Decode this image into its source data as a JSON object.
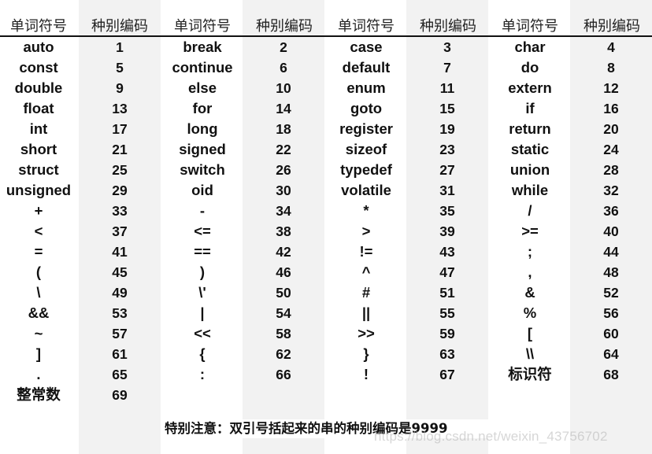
{
  "headers": {
    "symbol": "单词符号",
    "code": "种别编码"
  },
  "columns": [
    [
      {
        "symbol": "auto",
        "code": "1"
      },
      {
        "symbol": "const",
        "code": "5"
      },
      {
        "symbol": "double",
        "code": "9"
      },
      {
        "symbol": "float",
        "code": "13"
      },
      {
        "symbol": "int",
        "code": "17"
      },
      {
        "symbol": "short",
        "code": "21"
      },
      {
        "symbol": "struct",
        "code": "25"
      },
      {
        "symbol": "unsigned",
        "code": "29"
      },
      {
        "symbol": "+",
        "code": "33"
      },
      {
        "symbol": "<",
        "code": "37"
      },
      {
        "symbol": "=",
        "code": "41"
      },
      {
        "symbol": "(",
        "code": "45"
      },
      {
        "symbol": "\\",
        "code": "49"
      },
      {
        "symbol": "&&",
        "code": "53"
      },
      {
        "symbol": "~",
        "code": "57"
      },
      {
        "symbol": "]",
        "code": "61"
      },
      {
        "symbol": ".",
        "code": "65"
      },
      {
        "symbol": "整常数",
        "code": "69"
      }
    ],
    [
      {
        "symbol": "break",
        "code": "2"
      },
      {
        "symbol": "continue",
        "code": "6"
      },
      {
        "symbol": "else",
        "code": "10"
      },
      {
        "symbol": "for",
        "code": "14"
      },
      {
        "symbol": "long",
        "code": "18"
      },
      {
        "symbol": "signed",
        "code": "22"
      },
      {
        "symbol": "switch",
        "code": "26"
      },
      {
        "symbol": "oid",
        "code": "30"
      },
      {
        "symbol": "-",
        "code": "34"
      },
      {
        "symbol": "<=",
        "code": "38"
      },
      {
        "symbol": "==",
        "code": "42"
      },
      {
        "symbol": ")",
        "code": "46"
      },
      {
        "symbol": "\\'",
        "code": "50"
      },
      {
        "symbol": "|",
        "code": "54"
      },
      {
        "symbol": "<<",
        "code": "58"
      },
      {
        "symbol": "{",
        "code": "62"
      },
      {
        "symbol": ":",
        "code": "66"
      }
    ],
    [
      {
        "symbol": "case",
        "code": "3"
      },
      {
        "symbol": "default",
        "code": "7"
      },
      {
        "symbol": "enum",
        "code": "11"
      },
      {
        "symbol": "goto",
        "code": "15"
      },
      {
        "symbol": "register",
        "code": "19"
      },
      {
        "symbol": "sizeof",
        "code": "23"
      },
      {
        "symbol": "typedef",
        "code": "27"
      },
      {
        "symbol": "volatile",
        "code": "31"
      },
      {
        "symbol": "*",
        "code": "35"
      },
      {
        "symbol": ">",
        "code": "39"
      },
      {
        "symbol": "!=",
        "code": "43"
      },
      {
        "symbol": "^",
        "code": "47"
      },
      {
        "symbol": "#",
        "code": "51"
      },
      {
        "symbol": "||",
        "code": "55"
      },
      {
        "symbol": ">>",
        "code": "59"
      },
      {
        "symbol": "}",
        "code": "63"
      },
      {
        "symbol": "!",
        "code": "67"
      }
    ],
    [
      {
        "symbol": "char",
        "code": "4"
      },
      {
        "symbol": "do",
        "code": "8"
      },
      {
        "symbol": "extern",
        "code": "12"
      },
      {
        "symbol": "if",
        "code": "16"
      },
      {
        "symbol": "return",
        "code": "20"
      },
      {
        "symbol": "static",
        "code": "24"
      },
      {
        "symbol": "union",
        "code": "28"
      },
      {
        "symbol": "while",
        "code": "32"
      },
      {
        "symbol": "/",
        "code": "36"
      },
      {
        "symbol": ">=",
        "code": "40"
      },
      {
        "symbol": ";",
        "code": "44"
      },
      {
        "symbol": ",",
        "code": "48"
      },
      {
        "symbol": "&",
        "code": "52"
      },
      {
        "symbol": "%",
        "code": "56"
      },
      {
        "symbol": "[",
        "code": "60"
      },
      {
        "symbol": "\\\\",
        "code": "64"
      },
      {
        "symbol": "标识符",
        "code": "68"
      }
    ]
  ],
  "note": "特别注意：双引号括起来的串的种别编码是9999",
  "watermark": "https://blog.csdn.net/weixin_43756702",
  "colors": {
    "stripe": "#f2f2f2",
    "text": "#111111"
  }
}
